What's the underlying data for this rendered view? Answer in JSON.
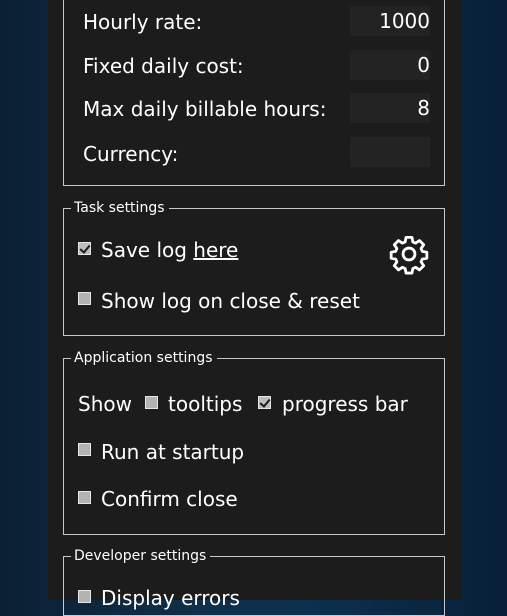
{
  "rate_settings": {
    "hourly_rate_label": "Hourly rate:",
    "hourly_rate_value": "1000",
    "fixed_daily_cost_label": "Fixed daily cost:",
    "fixed_daily_cost_value": "0",
    "max_daily_billable_label": "Max daily billable hours:",
    "max_daily_billable_value": "8",
    "currency_label": "Currency:",
    "currency_value": ""
  },
  "task_settings": {
    "title": "Task settings",
    "save_log_label": "Save log",
    "save_log_link": "here",
    "save_log_checked": true,
    "show_log_label": "Show log on close & reset",
    "show_log_checked": false,
    "settings_icon": "gear-icon"
  },
  "application_settings": {
    "title": "Application settings",
    "show_label": "Show",
    "tooltips_label": "tooltips",
    "tooltips_checked": false,
    "progress_bar_label": "progress bar",
    "progress_bar_checked": true,
    "run_at_startup_label": "Run at startup",
    "run_at_startup_checked": false,
    "confirm_close_label": "Confirm close",
    "confirm_close_checked": false
  },
  "developer_settings": {
    "title": "Developer settings",
    "display_errors_label": "Display errors",
    "display_errors_checked": false
  }
}
